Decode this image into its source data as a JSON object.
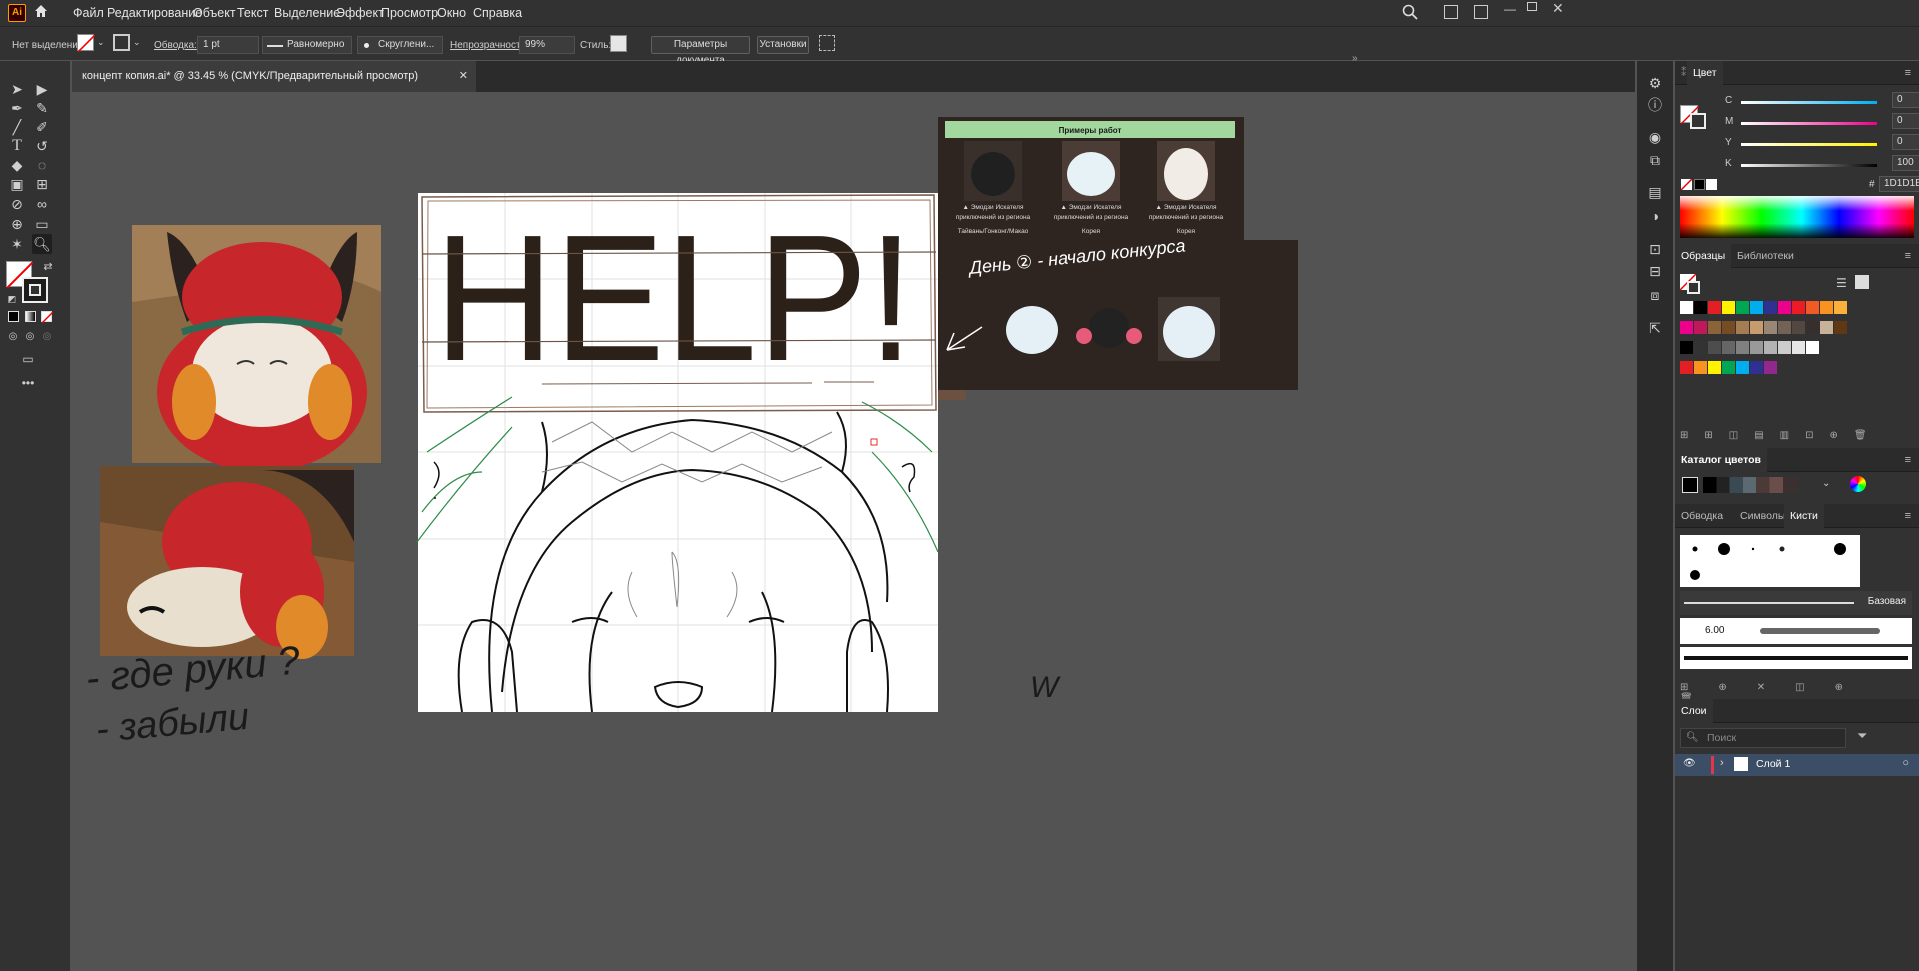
{
  "app": {
    "logo": "Ai"
  },
  "menu": [
    "Файл",
    "Редактирование",
    "Объект",
    "Текст",
    "Выделение",
    "Эффект",
    "Просмотр",
    "Окно",
    "Справка"
  ],
  "control_bar": {
    "selection": "Нет выделения",
    "stroke_label": "Обводка:",
    "stroke_value": "1 pt",
    "profile": "Равномерно",
    "brush": "Скруглени...",
    "opacity_label": "Непрозрачность:",
    "opacity_value": "99%",
    "style_label": "Стиль:",
    "doc_settings": "Параметры документа",
    "prefs": "Установки"
  },
  "document": {
    "tab_title": "концепт копия.ai* @ 33.45 % (CMYK/Предварительный просмотр)"
  },
  "artboard": {
    "headline": "HELP!"
  },
  "notes": {
    "hands": "- где руки ?",
    "forgot": "- забыли",
    "day_note": "День ② - начало конкурса",
    "scribble": "W"
  },
  "examples_card": {
    "title": "Примеры работ",
    "items": [
      {
        "line1": "▲ Эмодзи Искателя",
        "line2": "приключений из региона",
        "line3": "Тайвань/Гонконг/Макао"
      },
      {
        "line1": "▲ Эмодзи Искателя",
        "line2": "приключений из региона",
        "line3": "Корея"
      },
      {
        "line1": "▲ Эмодзи Искателя",
        "line2": "приключений из региона",
        "line3": "Корея"
      }
    ]
  },
  "color_panel": {
    "title": "Цвет",
    "channels": [
      {
        "name": "C",
        "value": "0",
        "unit": "%"
      },
      {
        "name": "M",
        "value": "0",
        "unit": "%"
      },
      {
        "name": "Y",
        "value": "0",
        "unit": "%"
      },
      {
        "name": "K",
        "value": "100",
        "unit": "%"
      }
    ],
    "hex": "1D1D1B"
  },
  "swatches_panel": {
    "tabs": [
      "Образцы",
      "Библиотеки"
    ],
    "row1": [
      "#ffffff",
      "#000000",
      "#e31e24",
      "#fff200",
      "#00a651",
      "#00aeef",
      "#2e3192",
      "#ec008c",
      "#ed1c24",
      "#f15a24",
      "#f7931e",
      "#fbb03b"
    ],
    "row2": [
      "#ec008c",
      "#c2185b",
      "#8c6239",
      "#754c24",
      "#a67c52",
      "#c69c6d",
      "#998675",
      "#736357",
      "#534741",
      "#362f2d",
      "#c7b299",
      "#603813"
    ],
    "row3": [
      "#000000",
      "#333333",
      "#4d4d4d",
      "#666666",
      "#808080",
      "#999999",
      "#b3b3b3",
      "#cccccc",
      "#e6e6e6",
      "#ffffff"
    ],
    "row4": [
      "#e31e24",
      "#f7931e",
      "#fff200",
      "#00a651",
      "#00aeef",
      "#2e3192",
      "#92278f"
    ]
  },
  "color_guide": {
    "title": "Каталог цветов"
  },
  "brushes_panel": {
    "tabs": [
      "Обводка",
      "Символы",
      "Кисти"
    ],
    "basic_label": "Базовая",
    "size_label": "6.00"
  },
  "layers_panel": {
    "title": "Слои",
    "search_placeholder": "Поиск",
    "layer_name": "Слой 1"
  },
  "colors": {
    "accent": "#a2d89d",
    "card_bg": "#2e2420",
    "help_text": "#2b2118"
  }
}
